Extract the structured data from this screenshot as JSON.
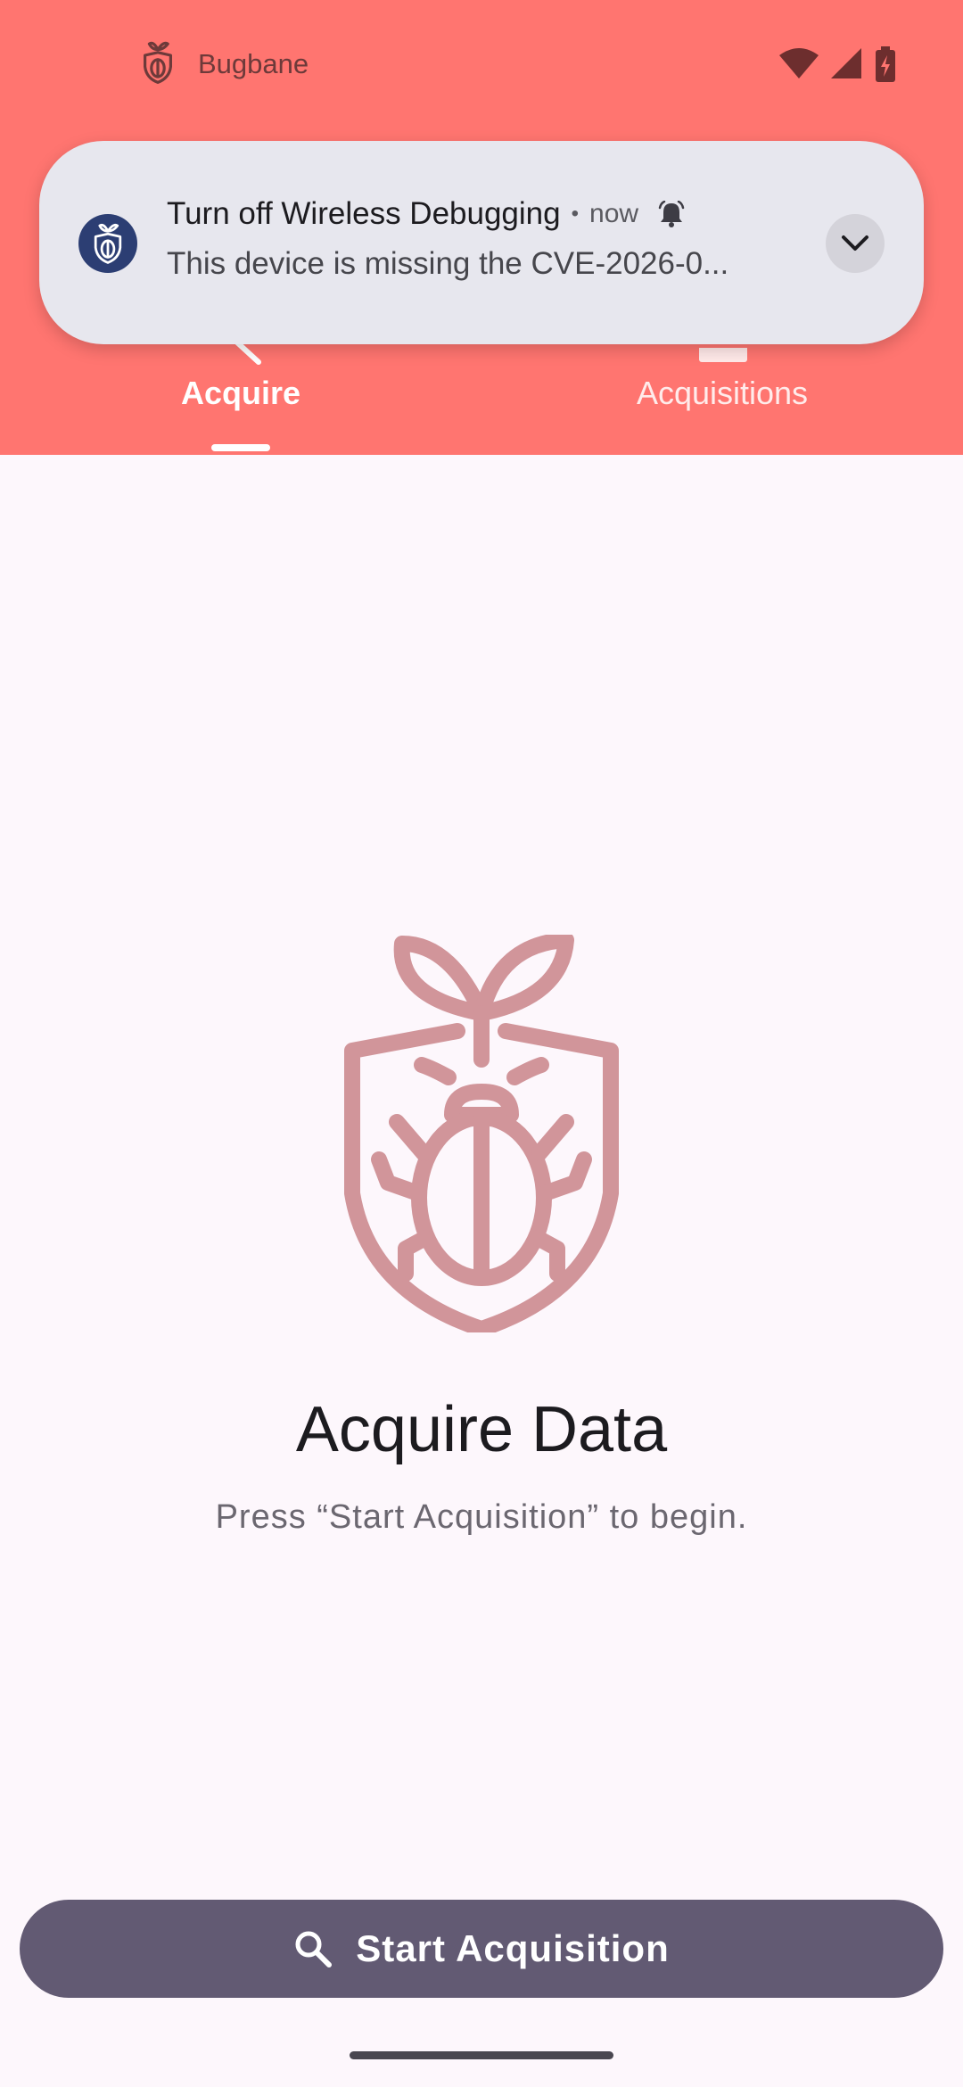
{
  "status_bar": {
    "app_icon": "bug-shield-icon",
    "app_name": "Bugbane",
    "icons": [
      "wifi-icon",
      "cell-signal-icon",
      "battery-charging-icon"
    ]
  },
  "notification": {
    "app_icon": "bug-shield-icon",
    "title": "Turn off Wireless Debugging",
    "separator": "•",
    "time": "now",
    "alert_icon": "bell-icon",
    "body": "This device is missing the CVE-2026-0...",
    "expand_icon": "chevron-down-icon"
  },
  "tabs": [
    {
      "label": "Acquire",
      "selected": true
    },
    {
      "label": "Acquisitions",
      "selected": false
    }
  ],
  "main": {
    "hero_icon": "bug-shield-icon",
    "title": "Acquire Data",
    "subtitle": "Press “Start Acquisition” to begin."
  },
  "action": {
    "icon": "search-icon",
    "label": "Start Acquisition"
  },
  "colors": {
    "header": "#ff7570",
    "background": "#fdf7fc",
    "button": "#625a73",
    "hero_icon": "#d1959a",
    "notification_bg": "#e7e7ee"
  }
}
